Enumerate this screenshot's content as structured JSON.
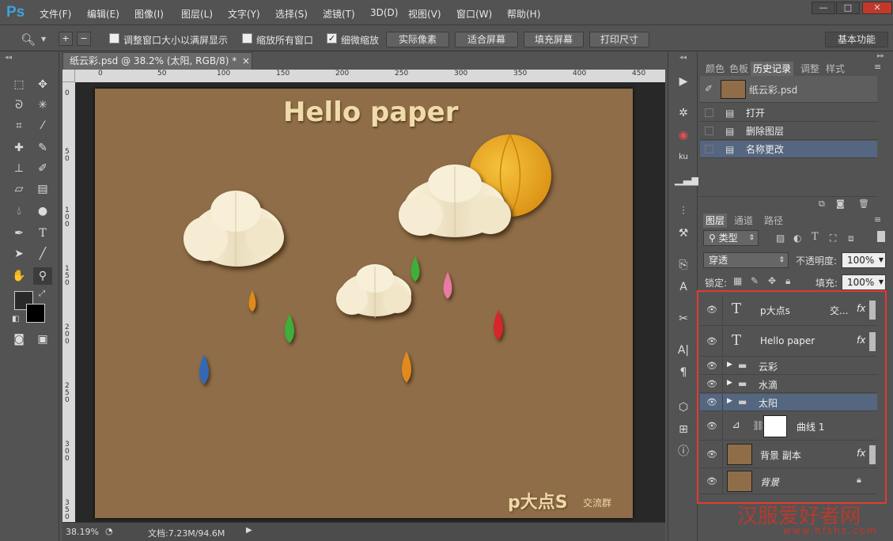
{
  "app": {
    "logo": "Ps"
  },
  "menu": [
    "文件(F)",
    "编辑(E)",
    "图像(I)",
    "图层(L)",
    "文字(Y)",
    "选择(S)",
    "滤镜(T)",
    "3D(D)",
    "视图(V)",
    "窗口(W)",
    "帮助(H)"
  ],
  "window_controls": {
    "minimize": "—",
    "maximize": "□",
    "close": "✕"
  },
  "options": {
    "resize_windows_label": "调整窗口大小以满屏显示",
    "zoom_all_label": "缩放所有窗口",
    "scrubby_zoom_label": "细微缩放",
    "actual_pixels": "实际像素",
    "fit_screen": "适合屏幕",
    "fill_screen": "填充屏幕",
    "print_size": "打印尺寸",
    "workspace": "基本功能"
  },
  "document": {
    "tab_title": "纸云彩.psd @ 38.2% (太阳, RGB/8) *",
    "tab_close": "×",
    "ruler_top_ticks": [
      "0",
      "50",
      "100",
      "150",
      "200",
      "250",
      "300",
      "350",
      "400",
      "450"
    ],
    "ruler_left_ticks": [
      "0",
      "5\n0",
      "1\n0\n0",
      "1\n5\n0",
      "2\n0\n0",
      "2\n5\n0",
      "3\n0\n0",
      "3\n5\n0"
    ],
    "canvas_title": "Hello paper",
    "canvas_brand": "p大点S",
    "canvas_brand_sub": "交流群"
  },
  "status": {
    "zoom": "38.19%",
    "doc_size": "文档:7.23M/94.6M"
  },
  "history_panel": {
    "tabs": [
      "颜色",
      "色板",
      "历史记录",
      "调整",
      "样式"
    ],
    "active_tab": "历史记录",
    "snapshot": "纸云彩.psd",
    "items": [
      "打开",
      "删除图层",
      "名称更改"
    ]
  },
  "layers_panel": {
    "tabs": [
      "图层",
      "通道",
      "路径"
    ],
    "filter_kind": "类型",
    "blend_mode": "穿透",
    "opacity_label": "不透明度:",
    "opacity_value": "100%",
    "lock_label": "锁定:",
    "fill_label": "填充:",
    "fill_value": "100%",
    "layers": [
      {
        "name": "p大点s",
        "extra": "交...",
        "fx": "fx"
      },
      {
        "name": "Hello paper",
        "fx": "fx"
      },
      {
        "name": "云彩"
      },
      {
        "name": "水滴"
      },
      {
        "name": "太阳"
      },
      {
        "name": "曲线 1"
      },
      {
        "name": "背景 副本",
        "fx": "fx"
      },
      {
        "name": "背景"
      }
    ]
  },
  "watermark": {
    "text": "汉服爱好者网",
    "url": "www.hfshz.com"
  },
  "colors": {
    "canvas_bg": "#8e6d48",
    "accent_red": "#e03c31",
    "ps_blue": "#3fa0e0",
    "selected_layer": "#546680"
  }
}
